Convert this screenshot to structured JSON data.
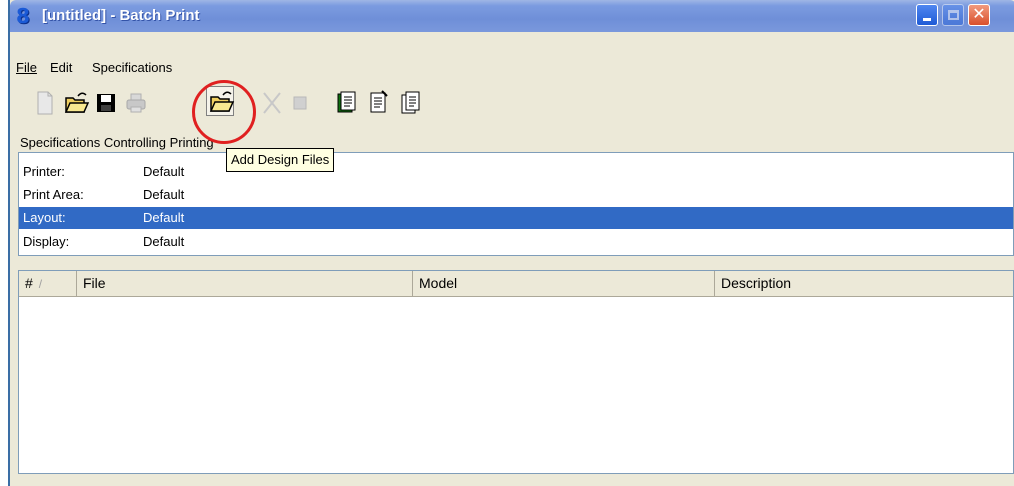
{
  "window": {
    "title": "[untitled] - Batch Print",
    "app_icon_glyph": "8",
    "min_glyph": "",
    "close_glyph": "✕"
  },
  "menu": {
    "items": [
      "File",
      "Edit",
      "Specifications"
    ]
  },
  "toolbar": {
    "icons": [
      "new-file-icon",
      "open-folder-icon",
      "save-disk-icon",
      "print-icon",
      "add-design-files-icon",
      "remove-file-icon",
      "stop-icon",
      "specifications-document-icon",
      "properties-document-icon",
      "copy-document-icon"
    ],
    "tooltip": "Add Design Files"
  },
  "specifications": {
    "label": "Specifications Controlling Printing",
    "rows": [
      {
        "name": "Printer:",
        "value": "Default"
      },
      {
        "name": "Print Area:",
        "value": "Default"
      },
      {
        "name": "Layout:",
        "value": "Default"
      },
      {
        "name": "Display:",
        "value": "Default"
      }
    ],
    "selected_row": "Layout:"
  },
  "file_list": {
    "columns": [
      "#",
      "File",
      "Model",
      "Description"
    ],
    "rows": []
  },
  "colors": {
    "titlebar": "#7b9be0",
    "selection": "#316ac5",
    "annotation_circle": "#e02020",
    "tooltip_bg": "#ffffe1"
  }
}
